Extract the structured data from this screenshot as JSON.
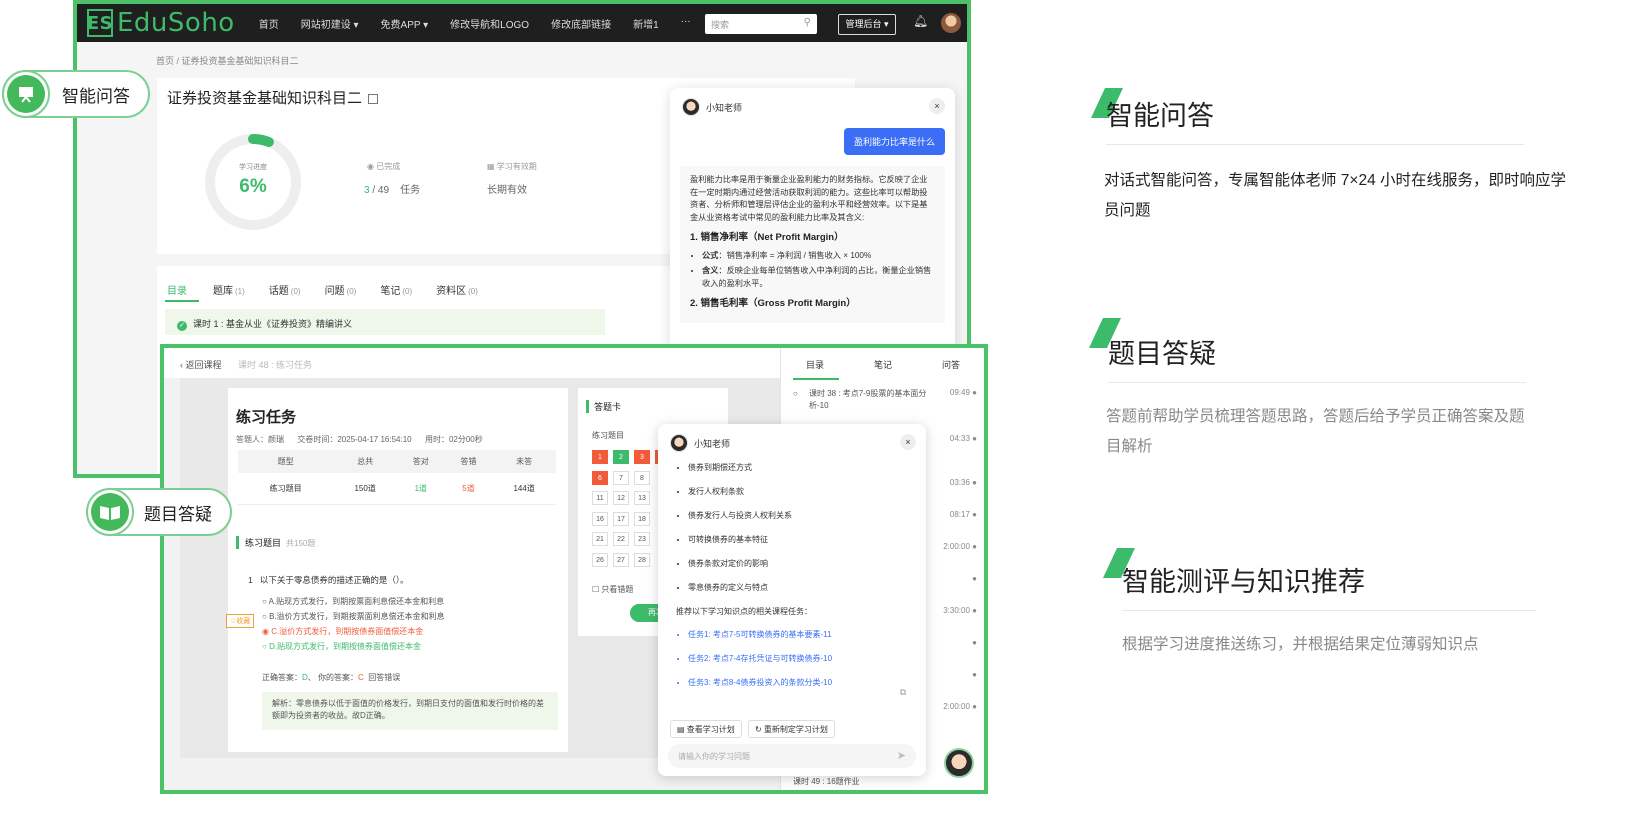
{
  "app": {
    "logo_text": "EduSoho",
    "logo_mark": "ES",
    "nav": [
      "首页",
      "网站初建设 ▾",
      "免费APP ▾",
      "修改导航和LOGO",
      "修改底部链接",
      "新增1",
      "···"
    ],
    "search_placeholder": "搜索",
    "admin_button": "管理后台 ▾"
  },
  "course": {
    "breadcrumb": "首页  /  证券投资基金基础知识科目二",
    "title": "证券投资基金基础知识科目二",
    "progress_label": "学习进度",
    "progress_value": "6%",
    "progress_fraction": 0.06,
    "completed_label": "已完成",
    "completed_value": "3",
    "completed_total": " / 49",
    "completed_unit": "任务",
    "validity_label": "学习有效期",
    "validity_value": "长期有效",
    "tabs": [
      {
        "label": "目录",
        "count": ""
      },
      {
        "label": "题库",
        "count": "(1)"
      },
      {
        "label": "话题",
        "count": "(0)"
      },
      {
        "label": "问题",
        "count": "(0)"
      },
      {
        "label": "笔记",
        "count": "(0)"
      },
      {
        "label": "资料区",
        "count": "(0)"
      }
    ],
    "lesson_row": "课时 1 : 基金从业《证券投资》精编讲义"
  },
  "chat1": {
    "bot_name": "小知老师",
    "close": "×",
    "user_message": "盈利能力比率是什么",
    "intro": "盈利能力比率是用于衡量企业盈利能力的财务指标。它反映了企业在一定时期内通过经营活动获取利润的能力。这些比率可以帮助投资者、分析师和管理层评估企业的盈利水平和经营效率。以下是基金从业资格考试中常见的盈利能力比率及其含义:",
    "h1": "1. 销售净利率（Net Profit Margin）",
    "b1_label": "公式",
    "b1": "：销售净利率 = 净利润 / 销售收入 × 100%",
    "b2_label": "含义",
    "b2": "：反映企业每单位销售收入中净利润的占比，衡量企业销售收入的盈利水平。",
    "h2": "2. 销售毛利率（Gross Profit Margin）"
  },
  "labels": {
    "qa": "智能问答",
    "answer": "题目答疑"
  },
  "exam": {
    "back": "‹ 返回课程",
    "lesson": "课时 48 : 练习任务",
    "title": "练习任务",
    "meta": "答题人：颜瑞      交卷时间：2025-04-17 16:54:10      用时：02分00秒",
    "table_headers": [
      "题型",
      "总共",
      "答对",
      "答错",
      "未答"
    ],
    "table_row": [
      "练习题目",
      "150道",
      "1道",
      "5道",
      "144道"
    ],
    "section": "练习题目",
    "section_count": "共150题",
    "q_no": "1",
    "question": "以下关于零息债券的描述正确的是（）。",
    "options": [
      "A.贴现方式发行，到期按票面利息偿还本金和利息",
      "B.溢价方式发行，到期按票面利息偿还本金和利息",
      "C.溢价方式发行，到期按债券面值偿还本金",
      "D.贴现方式发行，到期按债券面值偿还本金"
    ],
    "collect": "☆收藏",
    "answer_line_label": "正确答案：",
    "correct": "D",
    "your_label": "、 你的答案：",
    "yours": "C",
    "result": "回答错误",
    "analysis": "解析：零息债券以低于面值的价格发行，到期日支付的面值和发行时价格的差额即为投资者的收益。故D正确。",
    "card_title": "答题卡",
    "card_sub": "练习题目",
    "wrong_only": "只看错题",
    "retry": "再次答",
    "grid": [
      "1",
      "2",
      "3",
      "4",
      "6",
      "7",
      "8",
      "11",
      "12",
      "13",
      "16",
      "17",
      "18",
      "21",
      "22",
      "23",
      "26",
      "27",
      "28"
    ],
    "side_tabs": [
      "目录",
      "笔记",
      "问答"
    ],
    "side_item": "课时 38 : 考点7-9股票的基本面分析-10",
    "side_times": [
      "09:49",
      "04:33",
      "03:36",
      "08:17",
      "2:00:00",
      "",
      "3:30:00",
      "",
      "",
      "2:00:00"
    ],
    "side_bottom": "课时 49 : 16题作业"
  },
  "chat2": {
    "bot_name": "小知老师",
    "close": "×",
    "bullets": [
      "债券到期偿还方式",
      "发行人权利条款",
      "债券发行人与投资人权利关系",
      "可转换债券的基本特征",
      "债券条款对定价的影响",
      "零息债券的定义与特点"
    ],
    "recommend_title": "推荐以下学习知识点的相关课程任务：",
    "links": [
      "任务1: 考点7-5可转换债券的基本要素-11",
      "任务2: 考点7-4存托凭证与可转换债券-10",
      "任务3: 考点8-4债券投资入的条款分类-10"
    ],
    "btn1": "▤ 查看学习计划",
    "btn2": "↻ 重新制定学习计划",
    "input_placeholder": "请输入你的学习问题"
  },
  "features": [
    {
      "title": "智能问答",
      "desc": "对话式智能问答，专属智能体老师 7×24 小时在线服务，即时响应学员问题"
    },
    {
      "title": "题目答疑",
      "desc": "答题前帮助学员梳理答题思路，答题后给予学员正确答案及题目解析"
    },
    {
      "title": "智能测评与知识推荐",
      "desc": "根据学习进度推送练习，并根据结果定位薄弱知识点"
    }
  ],
  "colors": {
    "accent": "#3cbb6a",
    "link": "#3b6ef5",
    "error": "#f25b3a"
  }
}
